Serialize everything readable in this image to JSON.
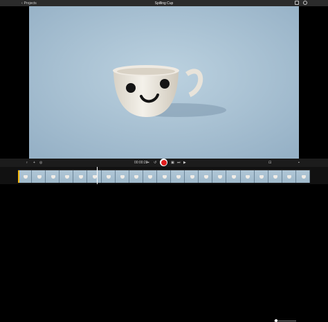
{
  "topbar": {
    "back_label": "Projects",
    "title": "Spilling Cup",
    "icons": [
      "share-icon",
      "help-icon"
    ]
  },
  "controls": {
    "timecode": "00:00:23",
    "left_icons": [
      "microphone-icon",
      "add-icon",
      "settings-icon"
    ],
    "transport_icons": [
      "skip-back-icon",
      "replay-icon",
      "record-icon",
      "snapshot-icon",
      "skip-forward-icon",
      "play-icon"
    ],
    "right_icons": [
      "zoom-icon",
      "fullscreen-icon"
    ],
    "colors": {
      "record": "#e11d1d"
    }
  },
  "timeline": {
    "frame_count": 21
  }
}
